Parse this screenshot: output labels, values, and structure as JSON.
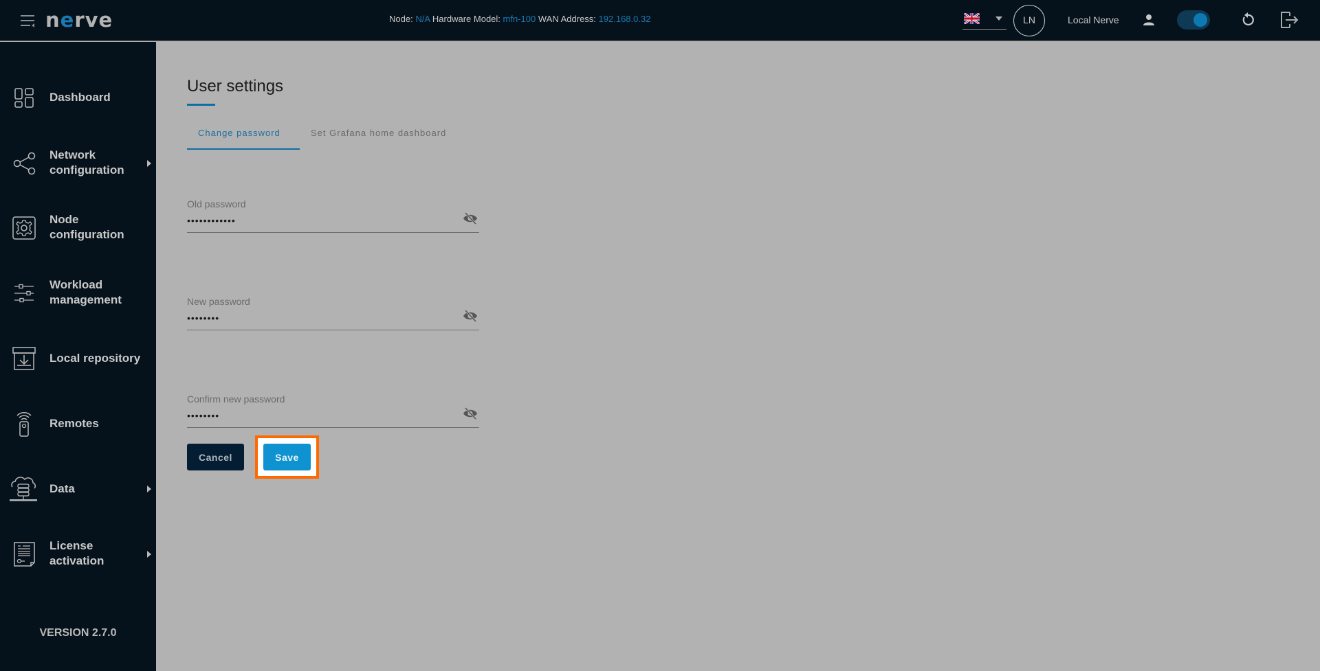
{
  "header": {
    "logo": {
      "prefix": "n",
      "accent": "e",
      "suffix": "rve"
    },
    "node_label": "Node:",
    "node_value": "N/A",
    "hardware_label": "Hardware Model:",
    "hardware_value": "mfn-100",
    "wan_label": "WAN Address:",
    "wan_value": "192.168.0.32",
    "language": "en-GB",
    "avatar_initials": "LN",
    "user_name": "Local Nerve",
    "toggle_on": true,
    "icons": [
      "menu-toggle-icon",
      "uk-flag-icon",
      "caret-down-icon",
      "person-icon",
      "refresh-icon",
      "logout-icon"
    ]
  },
  "sidebar": {
    "items": [
      {
        "label": "Dashboard",
        "icon": "dashboard-icon",
        "has_submenu": false
      },
      {
        "label_line1": "Network",
        "label_line2": "configuration",
        "icon": "share-network-icon",
        "has_submenu": true
      },
      {
        "label_line1": "Node",
        "label_line2": "configuration",
        "icon": "gear-icon",
        "has_submenu": false
      },
      {
        "label_line1": "Workload",
        "label_line2": "management",
        "icon": "sliders-icon",
        "has_submenu": false
      },
      {
        "label": "Local repository",
        "icon": "repository-download-icon",
        "has_submenu": false
      },
      {
        "label": "Remotes",
        "icon": "remote-control-icon",
        "has_submenu": false
      },
      {
        "label": "Data",
        "icon": "cloud-database-icon",
        "has_submenu": true
      },
      {
        "label_line1": "License",
        "label_line2": "activation",
        "icon": "license-document-icon",
        "has_submenu": true
      }
    ],
    "version": "VERSION 2.7.0"
  },
  "main": {
    "title": "User settings",
    "tabs": [
      {
        "label": "Change password",
        "active": true
      },
      {
        "label": "Set Grafana home dashboard",
        "active": false
      }
    ],
    "fields": [
      {
        "label": "Old password",
        "value": "••••••••••••"
      },
      {
        "label": "New password",
        "value": "••••••••"
      },
      {
        "label": "Confirm new password",
        "value": "••••••••"
      }
    ],
    "cancel_label": "Cancel",
    "save_label": "Save"
  },
  "colors": {
    "header_bg": "#06121b",
    "accent": "#1979b3",
    "save_button": "#0f92d0",
    "cancel_button": "#051d33",
    "highlight": "#ff6a00",
    "content_bg": "#b2b2b2"
  }
}
